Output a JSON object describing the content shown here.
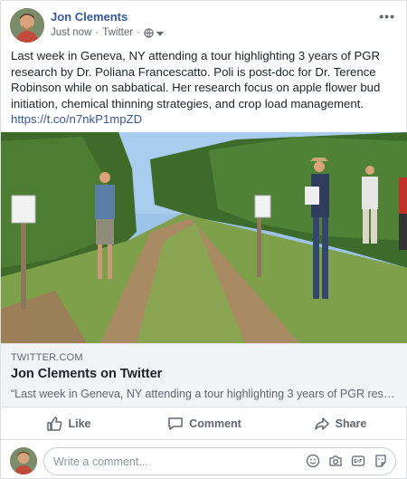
{
  "post": {
    "author": "Jon Clements",
    "timestamp": "Just now",
    "source": "Twitter",
    "separator": "·",
    "privacy_icon": "globe-icon",
    "more_label": "•••",
    "text": "Last week in Geneva, NY attending a tour highlighting 3 years of PGR research by Dr. Poliana Francescatto. Poli is post-doc for Dr. Terence Robinson while on sabbatical. Her research focus on apple flower bud initiation, chemical thinning strategies, and crop load management.",
    "link": "https://t.co/n7nkP1mpZD"
  },
  "preview": {
    "domain": "TWITTER.COM",
    "title": "Jon Clements on Twitter",
    "description": "“Last week in Geneva, NY attending a tour highlighting 3 years of PGR research by Dr. Poliana Francescatto."
  },
  "actions": {
    "like": "Like",
    "comment": "Comment",
    "share": "Share"
  },
  "comment_box": {
    "placeholder": "Write a comment..."
  },
  "colors": {
    "link": "#385898",
    "secondary_text": "#606770",
    "preview_bg": "#f2f3f5"
  }
}
